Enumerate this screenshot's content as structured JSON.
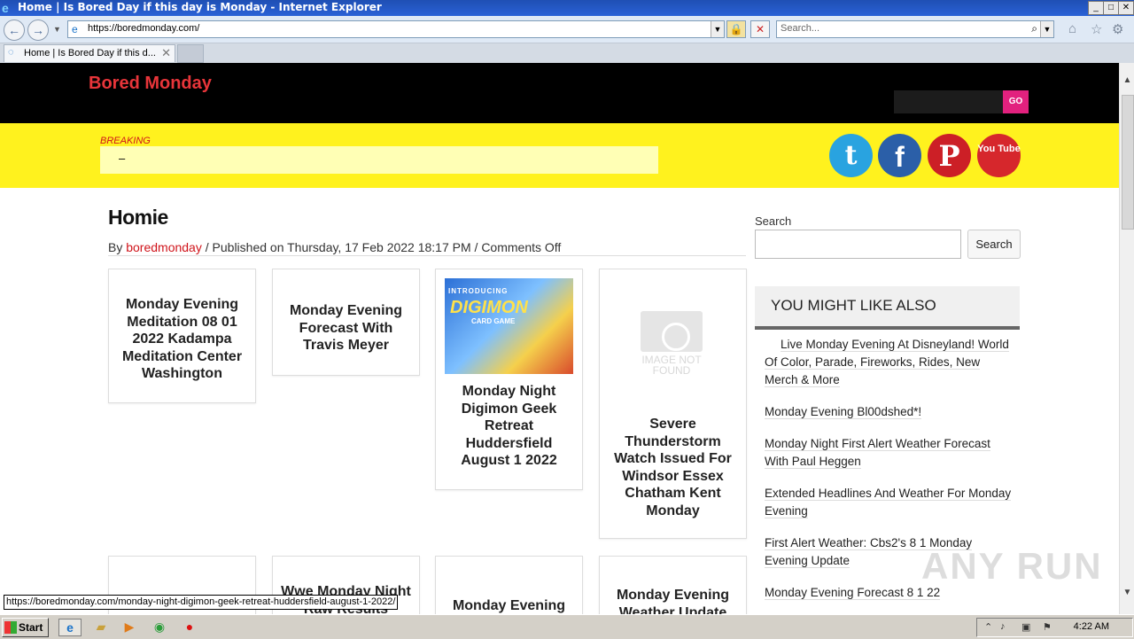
{
  "window": {
    "title": "Home | Is Bored Day if this day is Monday - Internet Explorer",
    "controls": [
      "_",
      "□",
      "✕"
    ]
  },
  "toolbar": {
    "back": "←",
    "forward": "→",
    "url": "https://boredmonday.com/",
    "lock": "🔒",
    "stop": "✕",
    "search_placeholder": "Search...",
    "search_icon": "⌕",
    "home_icon": "⌂",
    "fav_icon": "☆",
    "tools_icon": "⚙"
  },
  "tab": {
    "label": "Home | Is Bored Day if this d...",
    "close": "✕"
  },
  "site": {
    "name": "Bored Monday",
    "header_search_button": "GO",
    "breaking_label": "BREAKING",
    "breaking_text": "–",
    "social": {
      "twitter": "t",
      "facebook": "f",
      "pinterest": "P",
      "youtube": "You Tube"
    },
    "colors": {
      "brand_red": "#e8353a",
      "yellow_band": "#fff21e",
      "go_pink": "#e2217e"
    }
  },
  "post": {
    "title": "Homie",
    "by_prefix": "By ",
    "author": "boredmonday",
    "byline_rest": " / Published on Thursday, 17 Feb 2022 18:17 PM / Comments Off"
  },
  "cards": [
    {
      "title": "Monday Evening Meditation 08 01 2022 Kadampa Meditation Center Washington"
    },
    {
      "title": "Monday Evening Forecast With Travis Meyer"
    },
    {
      "title": "Monday Night Digimon Geek Retreat Huddersfield August 1 2022",
      "image_text_1": "INTRODUCING",
      "image_text_2": "DIGIMON",
      "image_text_3": "CARD GAME"
    },
    {
      "title": "Severe Thunderstorm Watch Issued For Windsor Essex Chatham Kent Monday",
      "image_text": "IMAGE NOT FOUND"
    },
    {
      "title": ""
    },
    {
      "title": "Wwe Monday Night Raw Results"
    },
    {
      "title": "Monday Evening"
    },
    {
      "title": "Monday Evening Weather Update"
    }
  ],
  "sidebar": {
    "search_label": "Search",
    "search_button": "Search",
    "you_might_like": "YOU MIGHT LIKE ALSO",
    "items": [
      "Live Monday Evening At Disneyland! World Of Color, Parade, Fireworks, Rides, New Merch & More",
      "Monday Evening Bl00dshed*!",
      "Monday Night First Alert Weather Forecast With Paul Heggen",
      "Extended Headlines And Weather For Monday Evening",
      "First Alert Weather: Cbs2's 8 1 Monday Evening Update",
      "Monday Evening Forecast 8 1 22"
    ]
  },
  "status_url": "https://boredmonday.com/monday-night-digimon-geek-retreat-huddersfield-august-1-2022/",
  "watermark": "ANY RUN",
  "taskbar": {
    "start": "Start",
    "time": "4:22 AM"
  }
}
